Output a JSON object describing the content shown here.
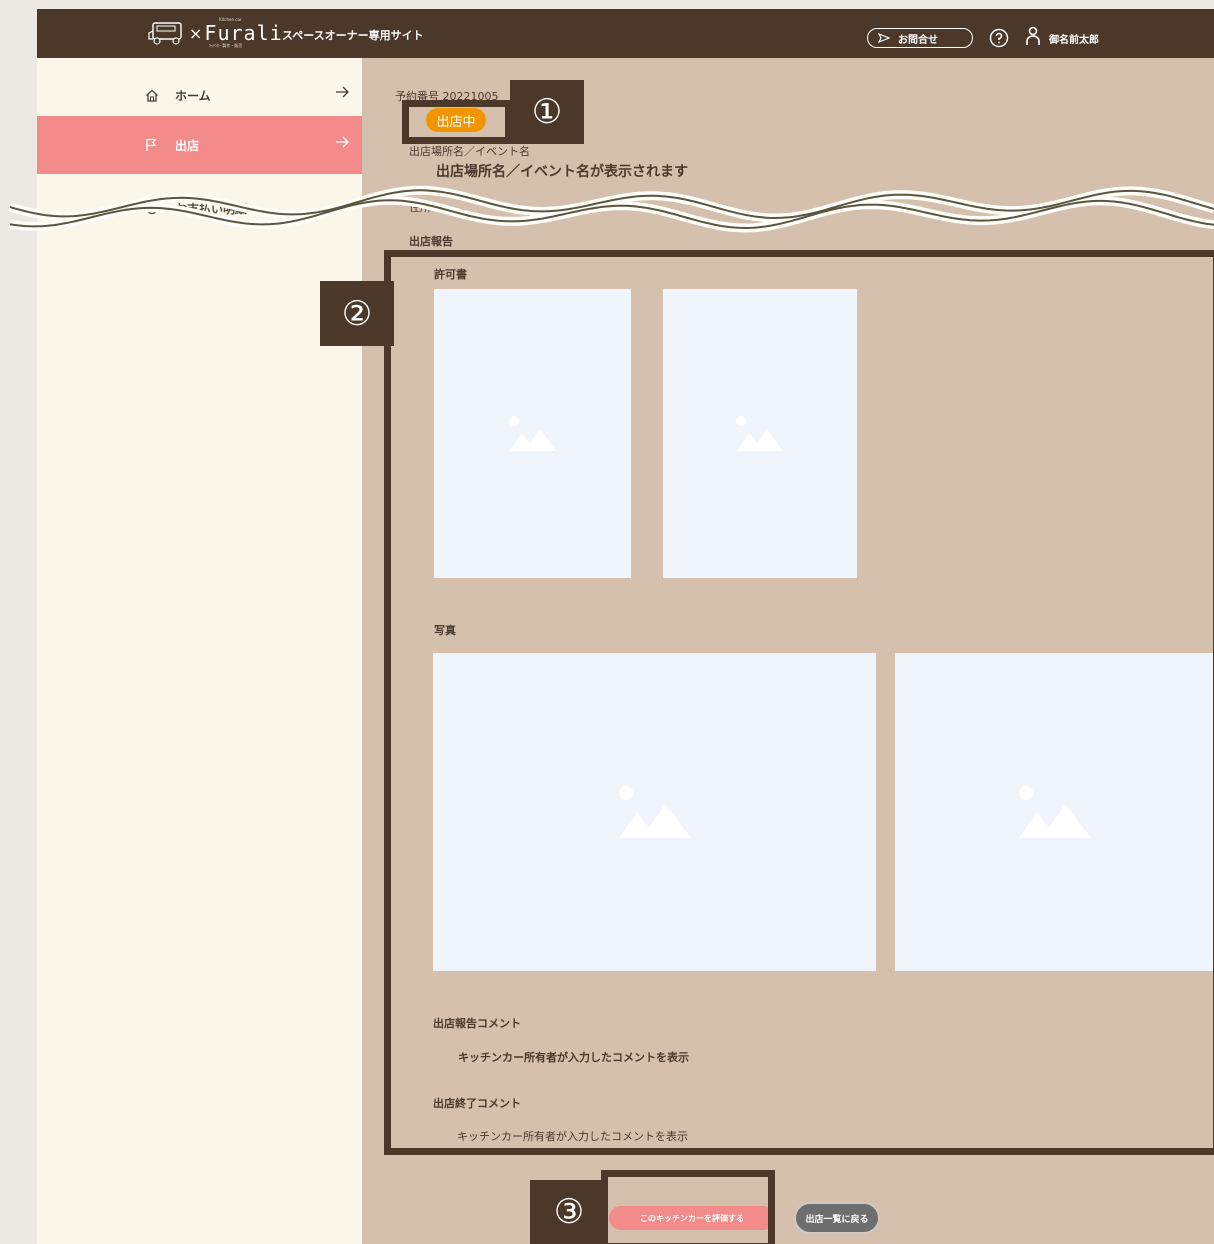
{
  "header": {
    "logo_brand": "Furali",
    "logo_kitchen_car": "Kitchen car",
    "logo_sub": "ｷｯﾁﾝｶｰ 製作・販売",
    "site_title": "スペースオーナー専用サイト",
    "contact_label": "お問合せ",
    "user_name": "御名前太郎"
  },
  "sidebar": {
    "items": [
      {
        "label": "ホーム",
        "icon": "home-icon"
      },
      {
        "label": "出店",
        "icon": "flag-icon"
      },
      {
        "label": "お支払い明細",
        "icon": "payment-icon"
      }
    ]
  },
  "main": {
    "reservation_label": "予約番号",
    "reservation_number": "20221005",
    "status_badge": "出店中",
    "location_label": "出店場所名／イベント名",
    "location_value": "出店場所名／イベント名が表示されます",
    "partial_label": "住所",
    "report_heading": "出店報告",
    "permit_label": "許可書",
    "photo_label": "写真",
    "report_comment_label": "出店報告コメント",
    "report_comment_value": "キッチンカー所有者が入力したコメントを表示",
    "end_comment_label": "出店終了コメント",
    "end_comment_value": "キッチンカー所有者が入力したコメントを表示"
  },
  "buttons": {
    "evaluate": "このキッチンカーを評価する",
    "back": "出店一覧に戻る"
  },
  "annotations": {
    "n1": "①",
    "n2": "②",
    "n3": "③"
  },
  "colors": {
    "header_bg": "#4b3828",
    "sidebar_bg": "#faf6ea",
    "active_nav": "#f28b89",
    "main_bg": "#d5bfad",
    "badge": "#f29600",
    "placeholder": "#eff5fb"
  }
}
